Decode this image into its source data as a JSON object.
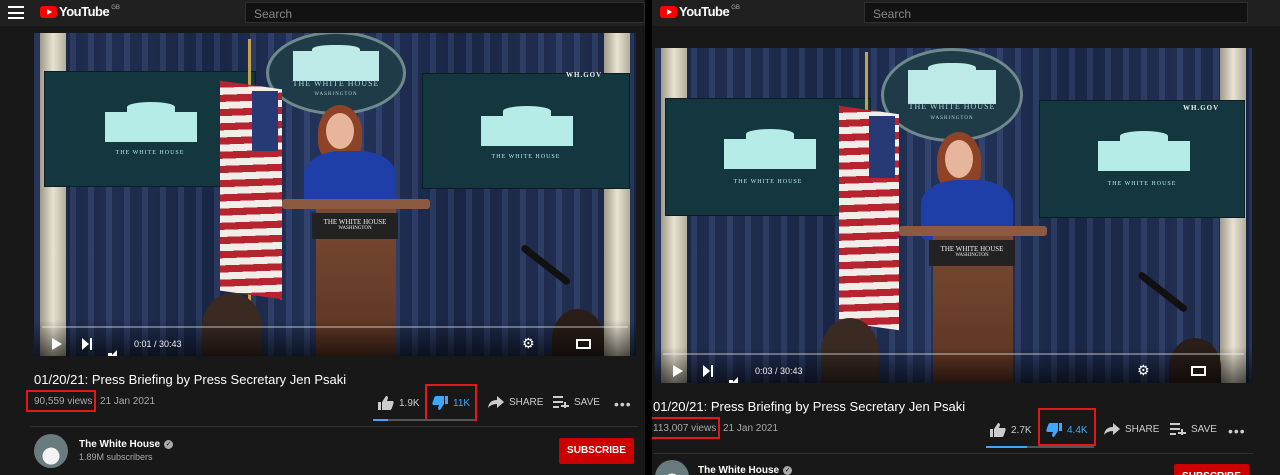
{
  "brand": {
    "wordmark": "YouTube",
    "region": "GB"
  },
  "search": {
    "placeholder": "Search"
  },
  "colors": {
    "highlight_box": "#e01a1a",
    "dislike_active": "#3ea6ff",
    "subscribe": "#cc0000"
  },
  "icons": [
    "menu-icon",
    "youtube-logo-icon",
    "play-icon",
    "next-icon",
    "volume-icon",
    "autoplay-toggle-icon",
    "subtitles-icon",
    "settings-gear-icon",
    "miniplayer-icon",
    "theater-mode-icon",
    "fullscreen-icon",
    "thumbs-up-icon",
    "thumbs-down-icon",
    "share-arrow-icon",
    "save-playlist-icon",
    "more-options-icon",
    "verified-check-icon"
  ],
  "video_scene": {
    "seal_title": "THE WHITE HOUSE",
    "seal_subtitle": "WASHINGTON",
    "screen_label": "THE WHITE HOUSE",
    "podium_title": "THE WHITE HOUSE",
    "podium_subtitle": "WASHINGTON",
    "site": "WH.GOV"
  },
  "left": {
    "player": {
      "time": "0:01 / 30:43",
      "progress": 0.0005
    },
    "title": "01/20/21: Press Briefing by Press Secretary Jen Psaki",
    "views": "90,559 views",
    "date": "21 Jan 2021",
    "likes": "1.9K",
    "dislikes": "11K",
    "like_ratio": 0.15,
    "share": "SHARE",
    "save": "SAVE",
    "more": "•••",
    "channel": {
      "name": "The White House",
      "subscribers": "1.89M subscribers"
    },
    "subscribe": "SUBSCRIBE"
  },
  "right": {
    "player": {
      "time": "0:03 / 30:43",
      "progress": 0.0016
    },
    "title": "01/20/21: Press Briefing by Press Secretary Jen Psaki",
    "views": "113,007 views",
    "date": "21 Jan 2021",
    "likes": "2.7K",
    "dislikes": "4.4K",
    "like_ratio": 0.38,
    "share": "SHARE",
    "save": "SAVE",
    "more": "•••",
    "channel": {
      "name": "The White House",
      "subscribers": ""
    },
    "subscribe": "SUBSCRIBE"
  }
}
